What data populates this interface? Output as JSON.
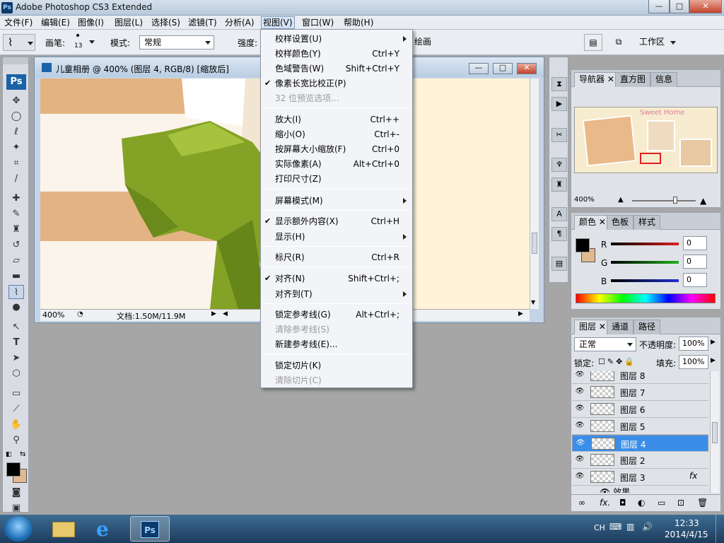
{
  "window": {
    "title": "Adobe Photoshop CS3 Extended",
    "app_icon": "Ps",
    "controls": [
      "—",
      "□",
      "✕"
    ]
  },
  "menubar": {
    "items": [
      "文件(F)",
      "编辑(E)",
      "图像(I)",
      "图层(L)",
      "选择(S)",
      "滤镜(T)",
      "分析(A)",
      "视图(V)",
      "窗口(W)",
      "帮助(H)"
    ],
    "active": "视图(V)"
  },
  "options": {
    "brush_label": "画笔:",
    "brush_size": "13",
    "mode_label": "模式:",
    "mode_value": "常规",
    "strength_label": "强度:",
    "sample_all": "绘画",
    "workspace": "工作区"
  },
  "toolbox": {
    "logo": "Ps"
  },
  "document": {
    "title": "儿童相册 @ 400% (图层 4, RGB/8) [缩放后]",
    "zoom": "400%",
    "doc_info": "文档:1.50M/11.9M"
  },
  "view_menu": {
    "items": [
      {
        "label": "校样设置(U)",
        "shortcut": "",
        "submenu": true,
        "disabled": false,
        "checked": false
      },
      {
        "label": "校样颜色(Y)",
        "shortcut": "Ctrl+Y",
        "submenu": false,
        "disabled": false,
        "checked": false
      },
      {
        "label": "色域警告(W)",
        "shortcut": "Shift+Ctrl+Y",
        "submenu": false,
        "disabled": false,
        "checked": false
      },
      {
        "label": "像素长宽比校正(P)",
        "shortcut": "",
        "submenu": false,
        "disabled": false,
        "checked": true
      },
      {
        "label": "32 位预览选项...",
        "shortcut": "",
        "submenu": false,
        "disabled": true,
        "checked": false
      },
      {
        "label": "放大(I)",
        "shortcut": "Ctrl++",
        "submenu": false,
        "disabled": false,
        "checked": false
      },
      {
        "label": "缩小(O)",
        "shortcut": "Ctrl+-",
        "submenu": false,
        "disabled": false,
        "checked": false
      },
      {
        "label": "按屏幕大小缩放(F)",
        "shortcut": "Ctrl+0",
        "submenu": false,
        "disabled": false,
        "checked": false
      },
      {
        "label": "实际像素(A)",
        "shortcut": "Alt+Ctrl+0",
        "submenu": false,
        "disabled": false,
        "checked": false
      },
      {
        "label": "打印尺寸(Z)",
        "shortcut": "",
        "submenu": false,
        "disabled": false,
        "checked": false
      },
      {
        "label": "屏幕模式(M)",
        "shortcut": "",
        "submenu": true,
        "disabled": false,
        "checked": false
      },
      {
        "label": "显示额外内容(X)",
        "shortcut": "Ctrl+H",
        "submenu": false,
        "disabled": false,
        "checked": true
      },
      {
        "label": "显示(H)",
        "shortcut": "",
        "submenu": true,
        "disabled": false,
        "checked": false
      },
      {
        "label": "标尺(R)",
        "shortcut": "Ctrl+R",
        "submenu": false,
        "disabled": false,
        "checked": false
      },
      {
        "label": "对齐(N)",
        "shortcut": "Shift+Ctrl+;",
        "submenu": false,
        "disabled": false,
        "checked": true
      },
      {
        "label": "对齐到(T)",
        "shortcut": "",
        "submenu": true,
        "disabled": false,
        "checked": false
      },
      {
        "label": "锁定参考线(G)",
        "shortcut": "Alt+Ctrl+;",
        "submenu": false,
        "disabled": false,
        "checked": false
      },
      {
        "label": "清除参考线(S)",
        "shortcut": "",
        "submenu": false,
        "disabled": true,
        "checked": false
      },
      {
        "label": "新建参考线(E)...",
        "shortcut": "",
        "submenu": false,
        "disabled": false,
        "checked": false
      },
      {
        "label": "锁定切片(K)",
        "shortcut": "",
        "submenu": false,
        "disabled": false,
        "checked": false
      },
      {
        "label": "清除切片(C)",
        "shortcut": "",
        "submenu": false,
        "disabled": true,
        "checked": false
      }
    ]
  },
  "navigator": {
    "tabs": [
      "导航器",
      "直方图",
      "信息"
    ],
    "zoom": "400%",
    "thumb_text": "Sweet Home"
  },
  "color_panel": {
    "tabs": [
      "颜色",
      "色板",
      "样式"
    ],
    "channels": [
      {
        "name": "R",
        "value": "0",
        "color": "#e02020"
      },
      {
        "name": "G",
        "value": "0",
        "color": "#20b020"
      },
      {
        "name": "B",
        "value": "0",
        "color": "#2030d0"
      }
    ]
  },
  "layers_panel": {
    "tabs": [
      "图层",
      "通道",
      "路径"
    ],
    "blend_mode": "正常",
    "opacity_label": "不透明度:",
    "opacity": "100%",
    "lock_label": "锁定:",
    "fill_label": "填充:",
    "fill": "100%",
    "layers": [
      "图层 8",
      "图层 7",
      "图层 6",
      "图层 5",
      "图层 4",
      "图层 2",
      "图层 3"
    ],
    "selected": "图层 4",
    "effects_label": "效果",
    "fx": "fx"
  },
  "taskbar": {
    "lang": "CH",
    "time": "12:33",
    "date": "2014/4/15",
    "ps_label": "Ps"
  },
  "colors": {
    "accent": "#3b8ee8",
    "fg_swatch": "#000000",
    "bg_swatch": "#e2b98e"
  }
}
